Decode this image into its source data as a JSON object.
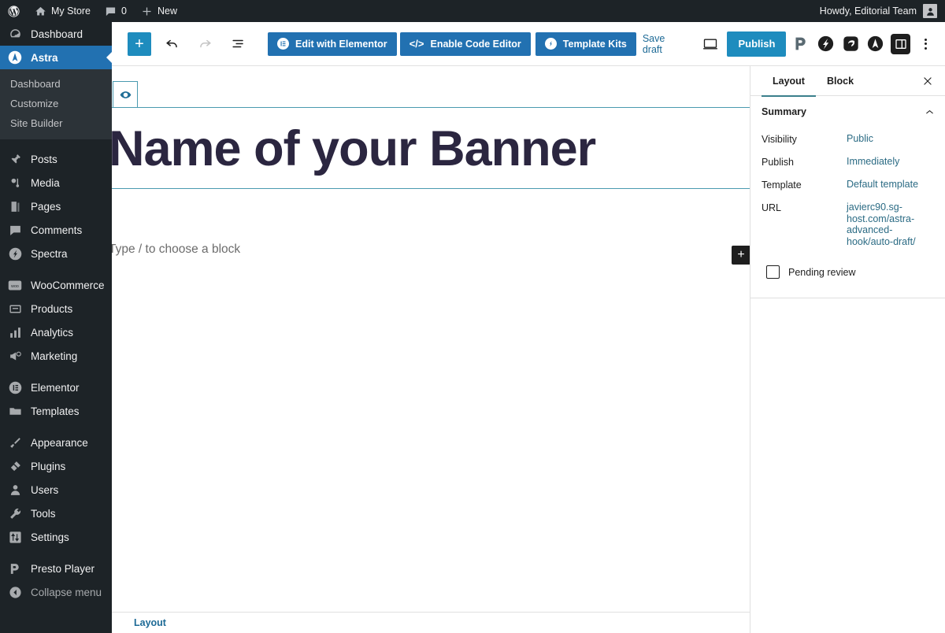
{
  "adminbar": {
    "wp_logo": "wordpress-logo-icon",
    "site_name": "My Store",
    "comments_count": "0",
    "new_label": "New",
    "howdy": "Howdy, Editorial Team"
  },
  "sidebar": {
    "items": [
      {
        "label": "Dashboard",
        "icon": "dashboard-icon",
        "current": false
      },
      {
        "label": "Astra",
        "icon": "astra-icon",
        "current": true
      },
      {
        "label": "Posts",
        "icon": "pin-icon",
        "current": false
      },
      {
        "label": "Media",
        "icon": "media-icon",
        "current": false
      },
      {
        "label": "Pages",
        "icon": "pages-icon",
        "current": false
      },
      {
        "label": "Comments",
        "icon": "comments-icon",
        "current": false
      },
      {
        "label": "Spectra",
        "icon": "spectra-icon",
        "current": false
      },
      {
        "label": "WooCommerce",
        "icon": "woocommerce-icon",
        "current": false
      },
      {
        "label": "Products",
        "icon": "products-icon",
        "current": false
      },
      {
        "label": "Analytics",
        "icon": "analytics-icon",
        "current": false
      },
      {
        "label": "Marketing",
        "icon": "marketing-icon",
        "current": false
      },
      {
        "label": "Elementor",
        "icon": "elementor-icon",
        "current": false
      },
      {
        "label": "Templates",
        "icon": "folder-icon",
        "current": false
      },
      {
        "label": "Appearance",
        "icon": "brush-icon",
        "current": false
      },
      {
        "label": "Plugins",
        "icon": "plugin-icon",
        "current": false
      },
      {
        "label": "Users",
        "icon": "user-icon",
        "current": false
      },
      {
        "label": "Tools",
        "icon": "wrench-icon",
        "current": false
      },
      {
        "label": "Settings",
        "icon": "settings-icon",
        "current": false
      },
      {
        "label": "Presto Player",
        "icon": "presto-player-icon",
        "current": false
      }
    ],
    "astra_submenu": [
      "Dashboard",
      "Customize",
      "Site Builder"
    ],
    "collapse_label": "Collapse menu",
    "collapse_icon": "collapse-arrow-icon"
  },
  "header": {
    "inserter_icon": "plus-icon",
    "undo_icon": "undo-icon",
    "redo_icon": "redo-icon",
    "list_view_icon": "list-view-icon",
    "edit_elementor": "Edit with Elementor",
    "enable_code_editor": "Enable Code Editor",
    "template_kits": "Template Kits",
    "save_draft": "Save draft",
    "preview_icon": "desktop-preview-icon",
    "publish": "Publish",
    "plugin_icons": [
      "presto-player-icon",
      "spectra-icon",
      "elementor-kit-icon",
      "astra-icon"
    ],
    "sidebar_toggle_icon": "settings-sidebar-icon",
    "options_icon": "kebab-menu-icon"
  },
  "canvas": {
    "eye_icon": "visibility-eye-icon",
    "post_title": "Name of your Banner",
    "block_placeholder": "Type / to choose a block",
    "add_block_icon": "plus-icon"
  },
  "footer": {
    "breadcrumb": "Layout"
  },
  "settings": {
    "tabs": [
      {
        "label": "Layout",
        "active": true
      },
      {
        "label": "Block",
        "active": false
      }
    ],
    "close_icon": "close-icon",
    "summary_title": "Summary",
    "collapse_icon": "chevron-up-icon",
    "rows": [
      {
        "label": "Visibility",
        "value": "Public"
      },
      {
        "label": "Publish",
        "value": "Immediately"
      },
      {
        "label": "Template",
        "value": "Default template"
      },
      {
        "label": "URL",
        "value": "javierc90.sg-host.com/astra-advanced-hook/auto-draft/"
      }
    ],
    "pending_review_label": "Pending review"
  },
  "colors": {
    "admin_dark": "#1d2327",
    "submenu_dark": "#2c3338",
    "accent_blue": "#2271b1",
    "publish_blue": "#1e8cbe",
    "link_teal": "#2b6b84",
    "title_color": "#2b2640",
    "rule_teal": "#4a9ab0"
  }
}
